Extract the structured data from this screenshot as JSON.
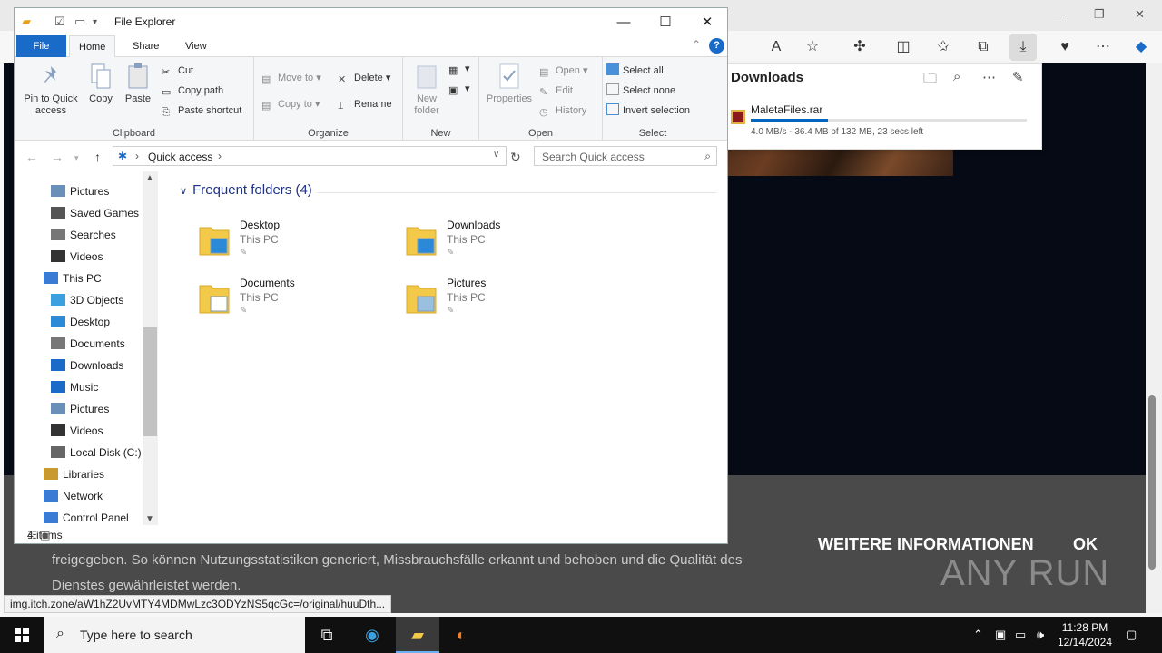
{
  "explorer": {
    "title": "File Explorer",
    "tabs": [
      {
        "label": "File"
      },
      {
        "label": "Home"
      },
      {
        "label": "Share"
      },
      {
        "label": "View"
      }
    ],
    "ribbon": {
      "clipboard": {
        "pin": "Pin to Quick access",
        "copy": "Copy",
        "paste": "Paste",
        "cut": "Cut",
        "copy_path": "Copy path",
        "paste_shortcut": "Paste shortcut",
        "label": "Clipboard"
      },
      "organize": {
        "move_to": "Move to",
        "copy_to": "Copy to",
        "delete": "Delete",
        "rename": "Rename",
        "label": "Organize"
      },
      "new": {
        "new_folder": "New folder",
        "label": "New"
      },
      "open": {
        "properties": "Properties",
        "open": "Open",
        "edit": "Edit",
        "history": "History",
        "label": "Open"
      },
      "select": {
        "select_all": "Select all",
        "select_none": "Select none",
        "invert": "Invert selection",
        "label": "Select"
      }
    },
    "address": {
      "crumb": "Quick access",
      "search_placeholder": "Search Quick access"
    },
    "nav_items": [
      {
        "label": "Pictures"
      },
      {
        "label": "Saved Games"
      },
      {
        "label": "Searches"
      },
      {
        "label": "Videos"
      },
      {
        "label": "This PC"
      },
      {
        "label": "3D Objects"
      },
      {
        "label": "Desktop"
      },
      {
        "label": "Documents"
      },
      {
        "label": "Downloads"
      },
      {
        "label": "Music"
      },
      {
        "label": "Pictures"
      },
      {
        "label": "Videos"
      },
      {
        "label": "Local Disk (C:)"
      },
      {
        "label": "Libraries"
      },
      {
        "label": "Network"
      },
      {
        "label": "Control Panel"
      }
    ],
    "section_title": "Frequent folders (4)",
    "folders": [
      {
        "name": "Desktop",
        "location": "This PC"
      },
      {
        "name": "Downloads",
        "location": "This PC"
      },
      {
        "name": "Documents",
        "location": "This PC"
      },
      {
        "name": "Pictures",
        "location": "This PC"
      }
    ],
    "status": "4 items"
  },
  "downloads_panel": {
    "title": "Downloads",
    "file_name": "MaletaFiles.rar",
    "progress": 0.28,
    "meta": "4.0 MB/s - 36.4 MB of 132 MB, 23 secs left"
  },
  "browser_page": {
    "cookie_text_line1": "freigegeben. So können Nutzungsstatistiken generiert, Missbrauchsfälle erkannt und behoben und die Qualität des",
    "cookie_text_line2": "Dienstes gewährleistet werden.",
    "more_info": "WEITERE INFORMATIONEN",
    "ok": "OK",
    "watermark": "ANY RUN",
    "status_url": "img.itch.zone/aW1hZ2UvMTY4MDMwLzc3ODYzNS5qcGc=/original/huuDth..."
  },
  "taskbar": {
    "search_placeholder": "Type here to search",
    "time": "11:28 PM",
    "date": "12/14/2024"
  },
  "colors": {
    "accent": "#1a6ac8",
    "section_blue": "#1e3287",
    "folder_yellow": "#f3c94a"
  }
}
